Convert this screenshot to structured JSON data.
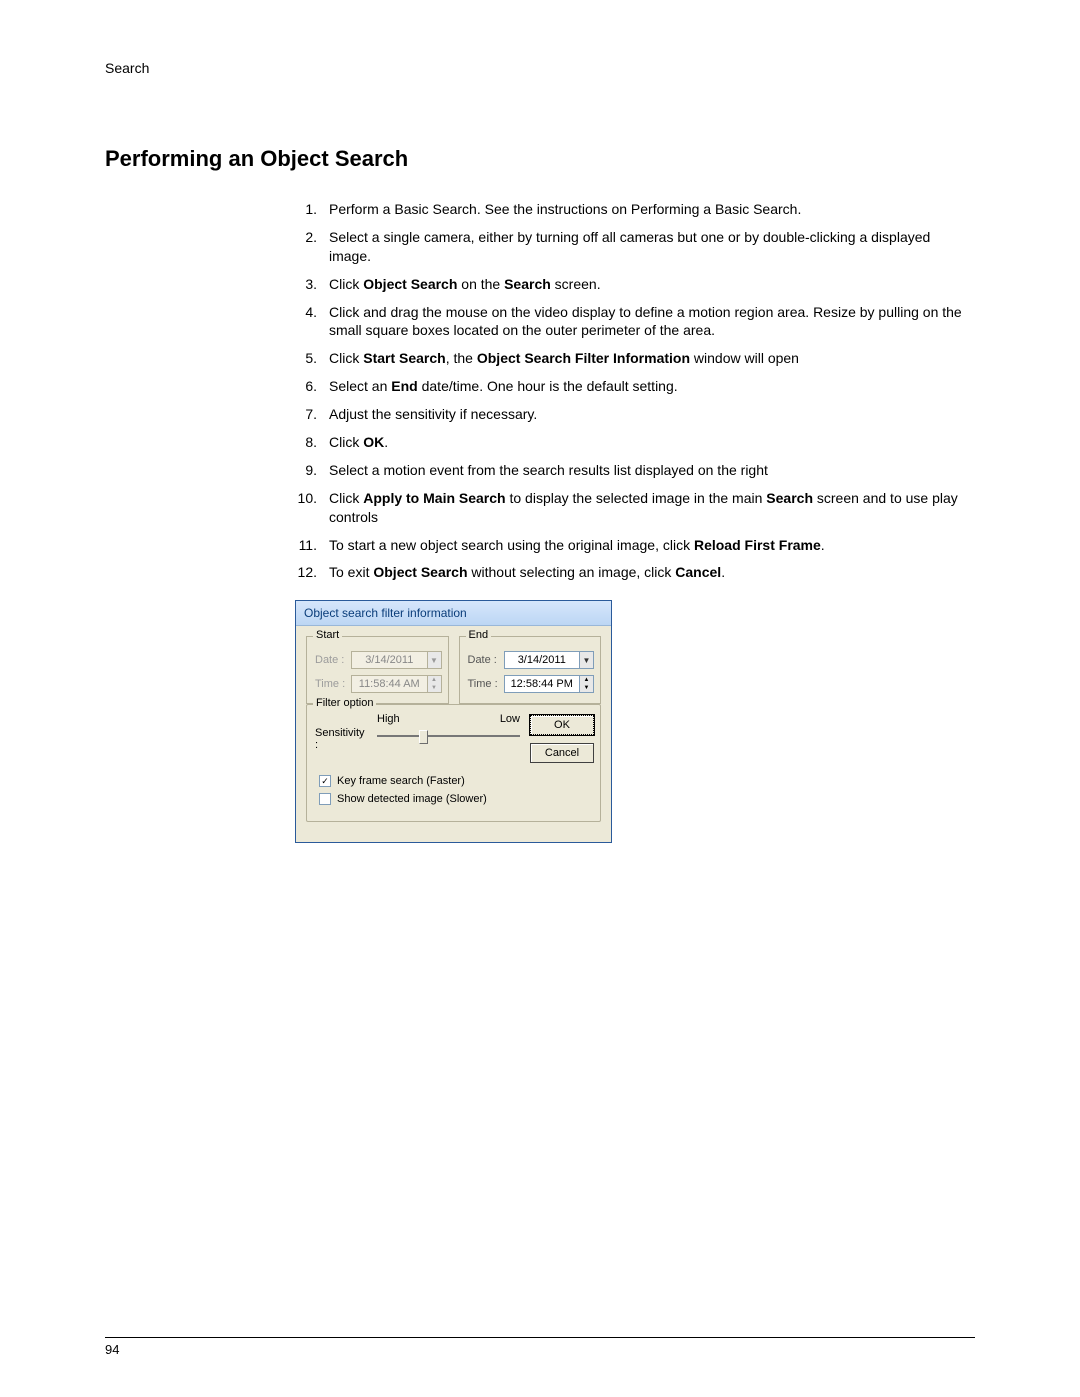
{
  "header": {
    "section": "Search"
  },
  "title": "Performing an Object Search",
  "steps": [
    {
      "n": "1.",
      "segs": [
        {
          "t": "Perform a Basic Search.  See the instructions on Performing a Basic Search."
        }
      ]
    },
    {
      "n": "2.",
      "segs": [
        {
          "t": "Select a single camera, either by turning off all cameras but one or by double-clicking a displayed image."
        }
      ]
    },
    {
      "n": "3.",
      "segs": [
        {
          "t": "Click "
        },
        {
          "t": "Object Search",
          "b": true
        },
        {
          "t": " on the "
        },
        {
          "t": "Search",
          "b": true
        },
        {
          "t": " screen."
        }
      ]
    },
    {
      "n": "4.",
      "segs": [
        {
          "t": "Click and drag the mouse on the video display to define a motion region area.  Resize by pulling on the small square boxes located on the outer perimeter of the area."
        }
      ]
    },
    {
      "n": "5.",
      "segs": [
        {
          "t": "Click "
        },
        {
          "t": "Start Search",
          "b": true
        },
        {
          "t": ", the "
        },
        {
          "t": "Object Search Filter Information",
          "b": true
        },
        {
          "t": " window will open"
        }
      ]
    },
    {
      "n": "6.",
      "segs": [
        {
          "t": "Select an "
        },
        {
          "t": "End",
          "b": true
        },
        {
          "t": " date/time.  One hour is the default setting."
        }
      ]
    },
    {
      "n": "7.",
      "segs": [
        {
          "t": "Adjust the sensitivity if necessary."
        }
      ]
    },
    {
      "n": "8.",
      "segs": [
        {
          "t": "Click "
        },
        {
          "t": "OK",
          "b": true
        },
        {
          "t": "."
        }
      ]
    },
    {
      "n": "9.",
      "segs": [
        {
          "t": "Select a motion event from the search results list displayed on the right"
        }
      ]
    },
    {
      "n": "10.",
      "segs": [
        {
          "t": "Click "
        },
        {
          "t": "Apply to Main Search",
          "b": true
        },
        {
          "t": " to display the selected image in the main "
        },
        {
          "t": "Search",
          "b": true
        },
        {
          "t": " screen and to use play controls"
        }
      ]
    },
    {
      "n": "11.",
      "segs": [
        {
          "t": "To start a new object search using the original image, click "
        },
        {
          "t": "Reload First Frame",
          "b": true
        },
        {
          "t": "."
        }
      ]
    },
    {
      "n": "12.",
      "segs": [
        {
          "t": "To exit "
        },
        {
          "t": "Object Search",
          "b": true
        },
        {
          "t": " without selecting an image, click "
        },
        {
          "t": "Cancel",
          "b": true
        },
        {
          "t": "."
        }
      ]
    }
  ],
  "dialog": {
    "title": "Object search filter information",
    "start": {
      "legend": "Start",
      "dateLabel": "Date :",
      "dateValue": "3/14/2011",
      "timeLabel": "Time :",
      "timeValue": "11:58:44 AM"
    },
    "end": {
      "legend": "End",
      "dateLabel": "Date :",
      "dateValue": "3/14/2011",
      "timeLabel": "Time :",
      "timeValue": "12:58:44 PM"
    },
    "filter": {
      "legend": "Filter option",
      "sensitivity": "Sensitivity :",
      "high": "High",
      "low": "Low"
    },
    "okLabel": "OK",
    "cancelLabel": "Cancel",
    "checks": {
      "keyframe": {
        "label": "Key frame search (Faster)",
        "checked": true
      },
      "showdetected": {
        "label": "Show detected image (Slower)",
        "checked": false
      }
    }
  },
  "footer": {
    "page": "94"
  }
}
